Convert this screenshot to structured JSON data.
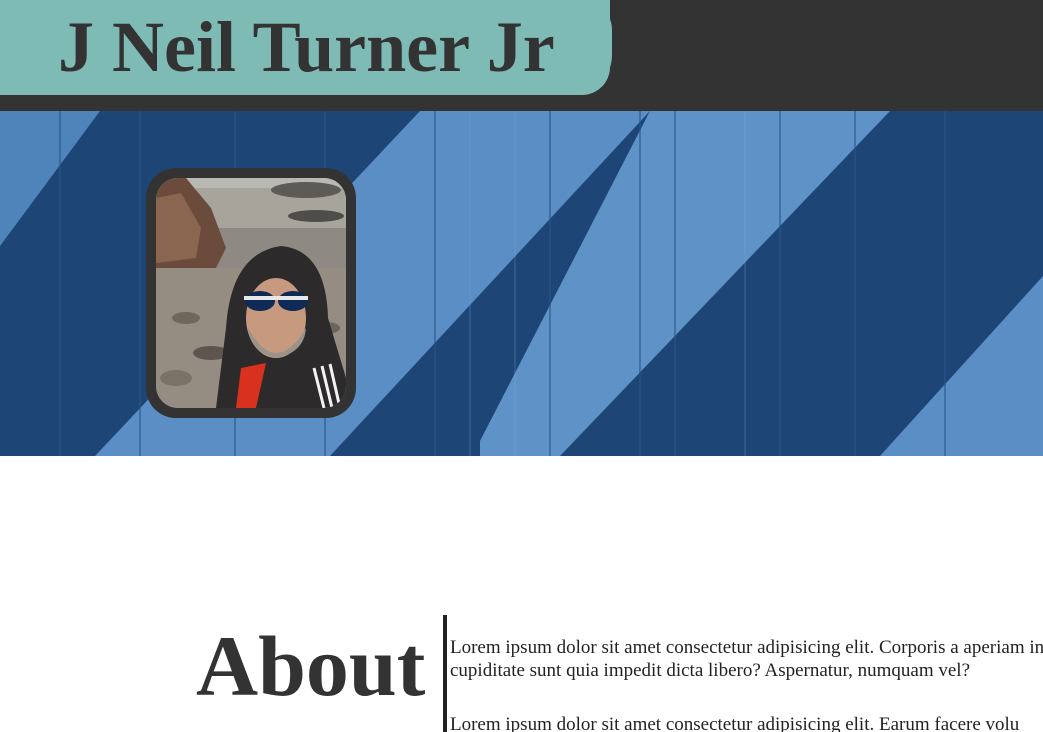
{
  "header": {
    "site_title": "J Neil Turner Jr",
    "accent_color": "#7dbbb4",
    "bar_color": "#333333"
  },
  "hero": {
    "background": "wooden-wall-diagonal-blue-stripes",
    "stripe_dark": "#1f4a7d",
    "stripe_light": "#5b8fc6"
  },
  "profile": {
    "photo_description": "profile-photo"
  },
  "about": {
    "heading": "About",
    "paragraphs": [
      "Lorem ipsum dolor sit amet consectetur adipisicing elit. Corporis a aperiam in cupiditate sunt quia impedit dicta libero? Aspernatur, numquam vel?",
      "Lorem ipsum dolor sit amet consectetur adipisicing elit. Earum facere volu"
    ]
  }
}
